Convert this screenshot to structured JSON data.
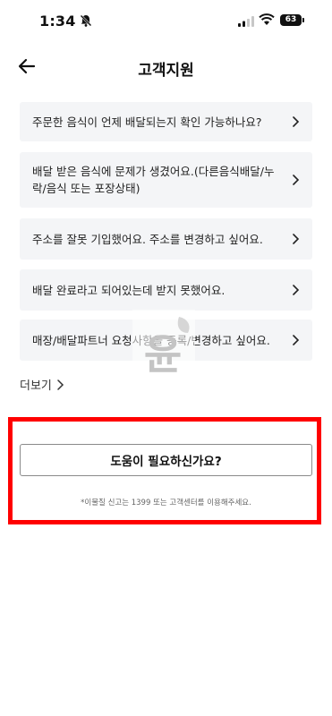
{
  "status_bar": {
    "time": "1:34",
    "battery": "63"
  },
  "header": {
    "title": "고객지원"
  },
  "faq": [
    {
      "text": "주문한 음식이 언제 배달되는지 확인 가능하나요?"
    },
    {
      "text": "배달 받은 음식에 문제가 생겼어요.(다른음식배달/누락/음식 또는 포장상태)"
    },
    {
      "text": "주소를 잘못 기입했어요. 주소를 변경하고 싶어요."
    },
    {
      "text": "배달 완료라고 되어있는데 받지 못했어요."
    },
    {
      "text": "매장/배달파트너 요청사항을 등록/변경하고 싶어요."
    }
  ],
  "more_label": "더보기",
  "help": {
    "button_label": "도움이 필요하신가요?",
    "notice": "*이물질 신고는 1399 또는 고객센터를 이용해주세요."
  },
  "watermark_text": "윤",
  "colors": {
    "highlight": "#ff0000",
    "item_bg": "#f4f5f7"
  }
}
